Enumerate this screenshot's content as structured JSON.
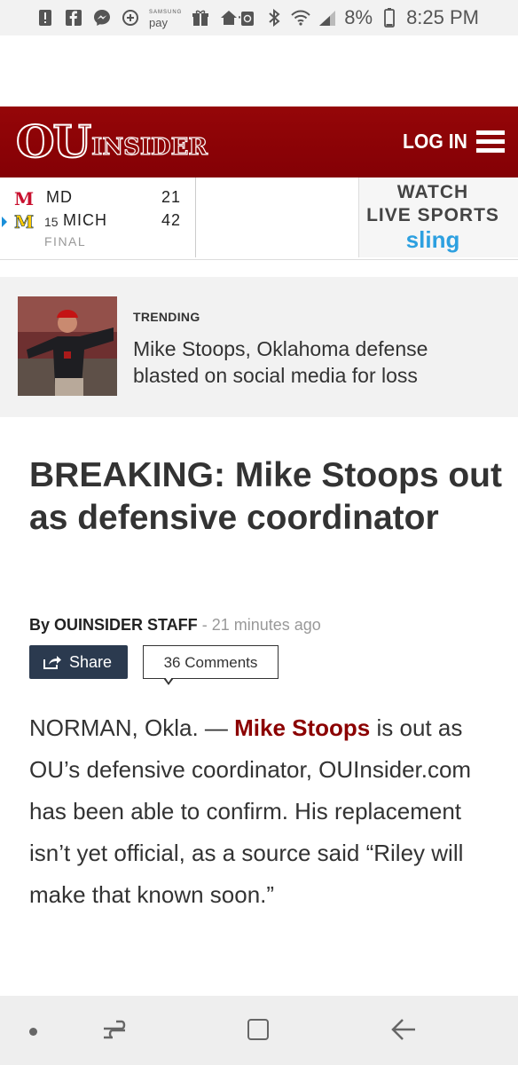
{
  "status_bar": {
    "pay_small": "SAMSUNG",
    "pay_label": "pay",
    "dots": "···",
    "battery": "8%",
    "time": "8:25 PM"
  },
  "header": {
    "logo_ou": "OU",
    "logo_insider": "INSIDER",
    "login": "LOG IN",
    "brand_color": "#8b0000"
  },
  "scoreboard": {
    "teams": [
      {
        "logo": "M",
        "logo_color": "#c8102e",
        "rank": "",
        "name": "MD",
        "score": "21"
      },
      {
        "logo": "M",
        "logo_color": "#ffcb05",
        "rank": "15",
        "name": "MICH",
        "score": "42"
      }
    ],
    "status": "FINAL",
    "ad_line1": "WATCH",
    "ad_line2": "LIVE SPORTS",
    "ad_brand": "sling"
  },
  "trending": {
    "label": "TRENDING",
    "title": "Mike Stoops, Oklahoma defense blasted on social media for loss"
  },
  "article": {
    "headline": "BREAKING: Mike Stoops out as defensive coordinator",
    "by_label": "By OUINSIDER STAFF",
    "time_ago": "- 21 minutes ago",
    "share_label": "Share",
    "comments_label": "36 Comments",
    "body_prefix": "NORMAN, Okla. — ",
    "body_link": "Mike Stoops",
    "body_rest": " is out as OU’s defensive coordinator, OUInsider.com has been able to confirm. His replacement isn’t yet official, as a source said “Riley will make that known soon.”"
  },
  "nav": {
    "icons": [
      "dot-icon",
      "recent-apps-icon",
      "home-icon",
      "back-icon"
    ]
  }
}
